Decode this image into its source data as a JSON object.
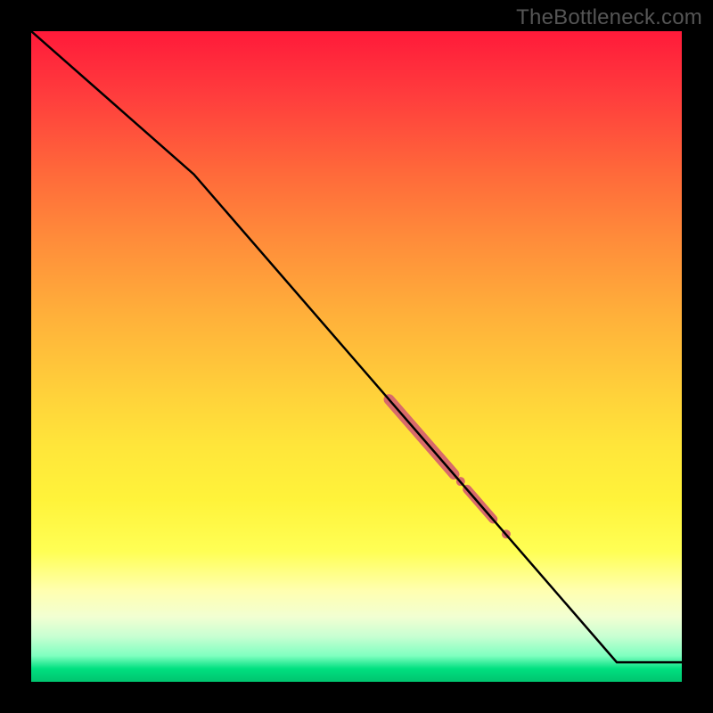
{
  "watermark": "TheBottleneck.com",
  "chart_data": {
    "type": "line",
    "title": "",
    "xlabel": "",
    "ylabel": "",
    "xlim": [
      0,
      100
    ],
    "ylim": [
      0,
      100
    ],
    "series": [
      {
        "name": "curve",
        "x": [
          0,
          25,
          90,
          100
        ],
        "y": [
          100,
          78,
          3,
          3
        ]
      }
    ],
    "highlight_segments": [
      {
        "x0": 55,
        "y0": 43.4,
        "x1": 65,
        "y1": 31.9,
        "width": 12
      },
      {
        "x0": 67,
        "y0": 29.6,
        "x1": 71,
        "y1": 25.0,
        "width": 10
      }
    ],
    "highlight_points": [
      {
        "x": 66,
        "y": 30.8,
        "r": 5
      },
      {
        "x": 73,
        "y": 22.7,
        "r": 5
      }
    ],
    "colors": {
      "curve": "#000000",
      "highlight": "#d86a6a"
    }
  }
}
